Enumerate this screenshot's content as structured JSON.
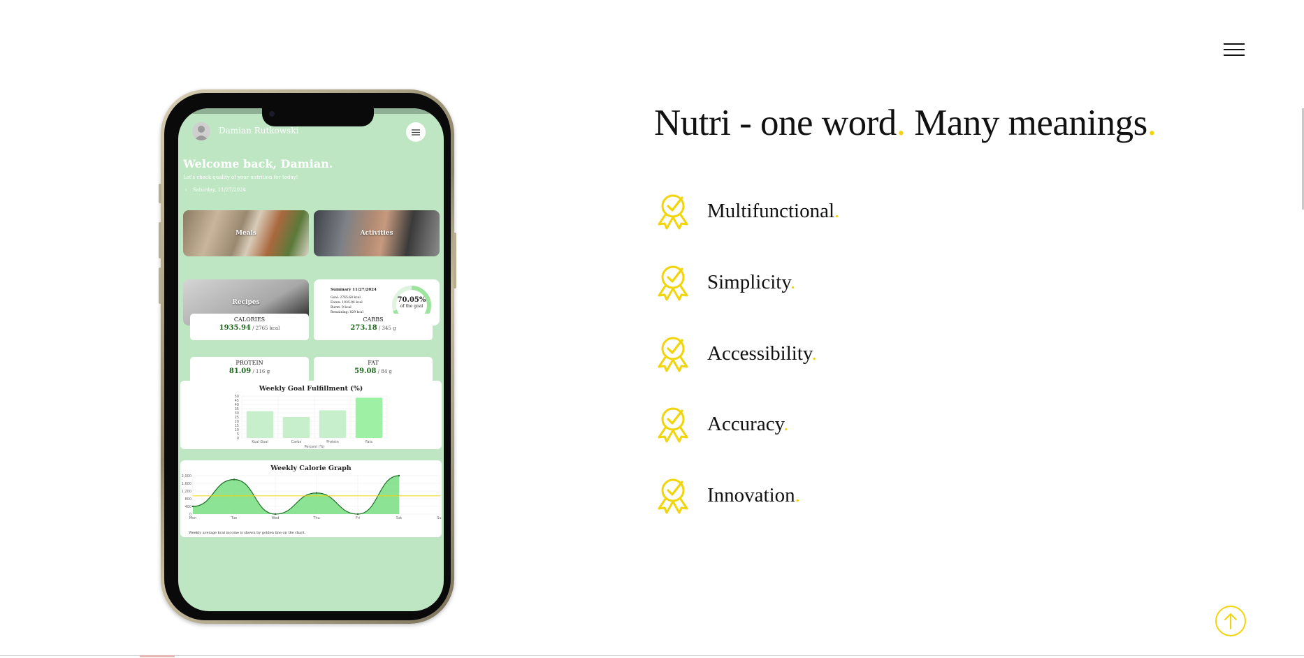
{
  "headline": {
    "text": "Nutri - one word",
    "dot1": ".",
    "text2": " Many meanings",
    "dot2": "."
  },
  "features": [
    {
      "label": "Multifunctional",
      "dot": "."
    },
    {
      "label": "Simplicity",
      "dot": "."
    },
    {
      "label": "Accessibility",
      "dot": "."
    },
    {
      "label": "Accuracy",
      "dot": "."
    },
    {
      "label": "Innovation",
      "dot": "."
    }
  ],
  "icons": {
    "feature": "award-ribbon-check-icon",
    "menu": "hamburger-menu-icon",
    "scroll_top": "arrow-up-icon"
  },
  "colors": {
    "accent": "#f2d40b",
    "app_bg": "#bfe6c3",
    "bar": "#c8efcb",
    "bar_highlight": "#9ef0a4",
    "line_fill": "#7fe088",
    "avg_line": "#f2d40b"
  },
  "phone": {
    "user_name": "Damian Rutkowski",
    "welcome": "Welcome back, Damian.",
    "subtitle": "Let's check quality of your nutrition for today!",
    "date_arrow": "‹",
    "date": "Saturday, 11/27/2024",
    "tiles": {
      "meals": "Meals",
      "activities": "Activities",
      "recipes": "Recipes"
    },
    "summary": {
      "title": "Summary 11/27/2024",
      "goal": "Goal: 2765.68 kcal",
      "eaten": "Eaten: 1935.94 kcal",
      "burnt": "Burnt: 0 kcal",
      "remaining": "Remaining: 829 kcal",
      "percent": "70.05%",
      "percent_label": "of the goal",
      "progress": 0.7005
    },
    "macros": [
      {
        "name": "CALORIES",
        "value": "1935.94",
        "target": " / 2765 kcal"
      },
      {
        "name": "CARBS",
        "value": "273.18",
        "target": " / 345 g"
      },
      {
        "name": "PROTEIN",
        "value": "81.09",
        "target": " / 116 g"
      },
      {
        "name": "FAT",
        "value": "59.08",
        "target": " / 84 g"
      }
    ]
  },
  "chart_data": [
    {
      "type": "bar",
      "title": "Weekly Goal Fulfillment (%)",
      "categories": [
        "Kcal Goal",
        "Carbs",
        "Protein",
        "Fats"
      ],
      "values": [
        32,
        25,
        33,
        48
      ],
      "highlight_index": 3,
      "xlabel": "Percent (%)",
      "ylabel": "",
      "ylim": [
        0,
        50
      ],
      "yticks": [
        0,
        5,
        10,
        15,
        20,
        25,
        30,
        35,
        40,
        45,
        50
      ],
      "grid": true
    },
    {
      "type": "area",
      "title": "Weekly Calorie Graph",
      "categories": [
        "Mon",
        "Tue",
        "Wed",
        "Thu",
        "Fri",
        "Sat",
        "Sun"
      ],
      "values": [
        400,
        1800,
        0,
        1100,
        0,
        2000,
        null
      ],
      "average": 950,
      "ylim": [
        0,
        2000
      ],
      "yticks": [
        0,
        400,
        800,
        1200,
        1600,
        2000
      ],
      "ytick_labels": [
        "0",
        "400",
        "800",
        "1,200",
        "1,600",
        "2,000"
      ],
      "note": "Weekly average kcal income is shown by golden line on the chart.",
      "grid": true
    }
  ]
}
